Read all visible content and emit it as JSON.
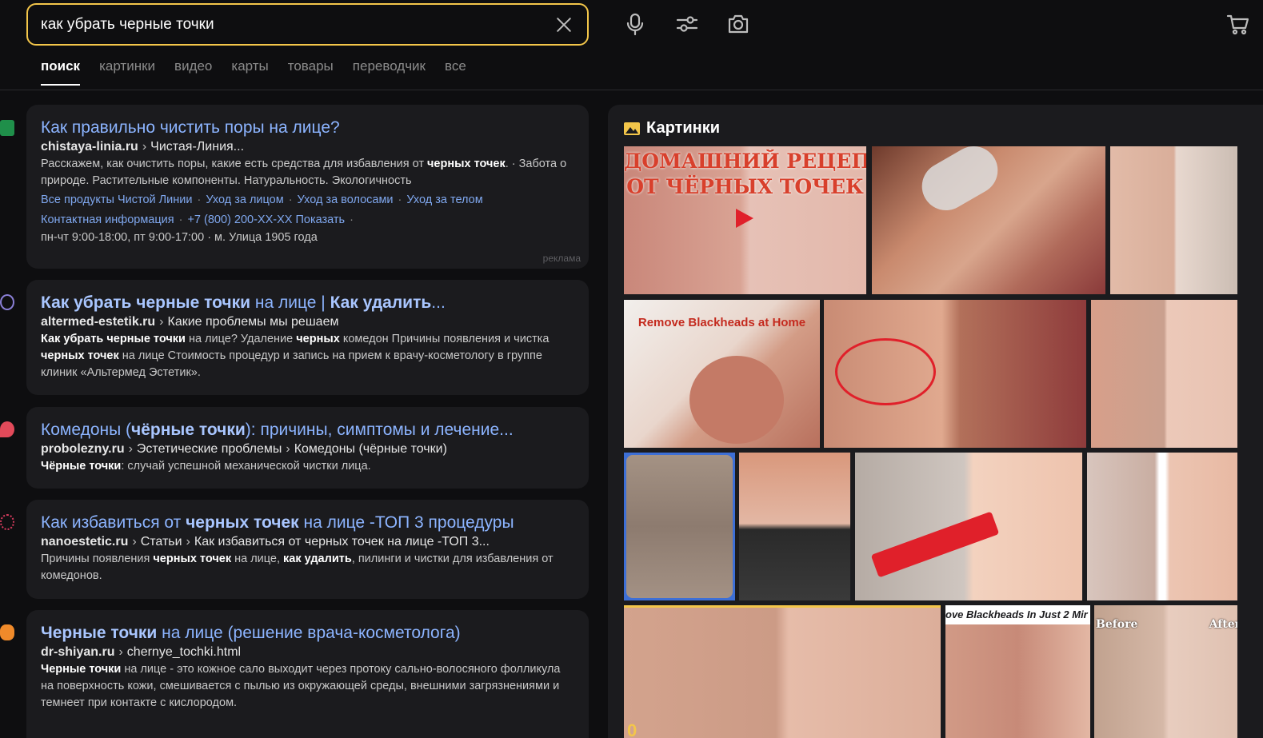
{
  "search": {
    "query": "как убрать черные точки"
  },
  "tabs": [
    {
      "label": "поиск",
      "active": true
    },
    {
      "label": "картинки",
      "active": false
    },
    {
      "label": "видео",
      "active": false
    },
    {
      "label": "карты",
      "active": false
    },
    {
      "label": "товары",
      "active": false
    },
    {
      "label": "переводчик",
      "active": false
    },
    {
      "label": "все",
      "active": false
    }
  ],
  "header_icons": [
    "microphone-icon",
    "filters-icon",
    "camera-icon",
    "cart-icon"
  ],
  "results": [
    {
      "favicon": "chistaya-linia-favicon",
      "favicon_color": "#1f8f4a",
      "title": "Как правильно чистить поры на лице?",
      "host": "chistaya-linia.ru",
      "path": [
        "Чистая-Линия..."
      ],
      "snippet": [
        "Расскажем, как очистить поры, какие есть средства для избавления от ",
        "черных точек",
        ". · Забота о природе. Растительные компоненты. Натуральность. Экологичность"
      ],
      "links": [
        "Все продукты Чистой Линии",
        "Уход за лицом",
        "Уход за волосами",
        "Уход за телом"
      ],
      "links2": [
        "Контактная информация",
        "+7 (800) 200-XX-XX Показать"
      ],
      "info": "пн-чт 9:00-18:00, пт 9:00-17:00 · м. Улица 1905 года",
      "ad_label": "реклама"
    },
    {
      "favicon": "altermed-favicon",
      "favicon_color": "#8a7fd6",
      "title_parts": [
        [
          "Как убрать черные точки",
          true
        ],
        [
          " на лице | ",
          false
        ],
        [
          "Как удалить",
          true
        ],
        [
          "...",
          false
        ]
      ],
      "host": "altermed-estetik.ru",
      "path": [
        "Какие проблемы мы решаем"
      ],
      "snippet": [
        "Как убрать черные точки",
        " на лице? Удаление ",
        "черных",
        " комедон Причины появления и чистка ",
        "черных точек",
        " на лице Стоимость процедур и запись на прием к врачу-косметологу в группе клиник «Альтермед Эстетик»."
      ]
    },
    {
      "favicon": "probolezny-favicon",
      "favicon_color": "#e24a5a",
      "title_parts": [
        [
          "Комедоны (",
          false
        ],
        [
          "чёрные точки",
          true
        ],
        [
          "): причины, симптомы и лечение...",
          false
        ]
      ],
      "host": "probolezny.ru",
      "path": [
        "Эстетические проблемы",
        "Комедоны (чёрные точки)"
      ],
      "snippet": [
        "Чёрные точки",
        ": случай успешной механической чистки лица."
      ]
    },
    {
      "favicon": "nanoestetic-favicon",
      "favicon_color": "#d63c5e",
      "title_parts": [
        [
          "Как избавиться от ",
          false
        ],
        [
          "черных точек",
          true
        ],
        [
          " на лице -ТОП 3 процедуры",
          false
        ]
      ],
      "host": "nanoestetic.ru",
      "path": [
        "Статьи",
        "Как избавиться от черных точек на лице -ТОП 3..."
      ],
      "snippet": [
        "Причины появления ",
        "черных точек",
        " на лице, ",
        "как удалить",
        ", пилинги и чистки для избавления от комедонов."
      ]
    },
    {
      "favicon": "dr-shiyan-favicon",
      "favicon_color": "#f08a2a",
      "title_parts": [
        [
          "Черные точки",
          true
        ],
        [
          " на лице (решение врача-косметолога)",
          false
        ]
      ],
      "host": "dr-shiyan.ru",
      "path": [
        "chernye_tochki.html"
      ],
      "snippet": [
        "Черные точки",
        " на лице - это кожное сало выходит через протоку сально-волосяного фолликула на поверхность кожи, смешивается с пылью из окружающей среды, внешними загрязнениями и темнеет при контакте с кислородом."
      ]
    }
  ],
  "images": {
    "title": "Картинки",
    "captions": {
      "recipe_line1": "ДОМАШНИЙ РЕЦЕПТ",
      "recipe_line2": "ОТ ЧЁРНЫХ ТОЧЕК",
      "remove_home": "Remove Blackheads at Home",
      "remove_2min": "ove Blackheads In Just 2 Mir",
      "before": "Before",
      "after": "After",
      "partial_digit": "0"
    }
  },
  "colors": {
    "accent_yellow": "#f3c64a",
    "link_blue": "#8cb4ff",
    "background": "#0e0e10",
    "card": "#1b1b1e"
  }
}
